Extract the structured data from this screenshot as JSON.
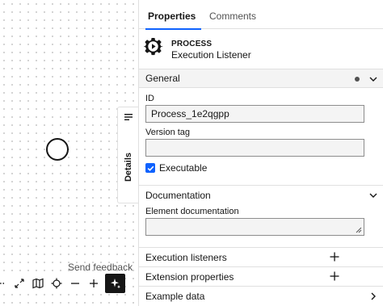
{
  "canvas": {
    "details_tab_label": "Details",
    "feedback_label": "Send feedback"
  },
  "toolbar": {
    "icons": [
      "partial-icon",
      "fullscreen-icon",
      "map-icon",
      "crosshair-icon",
      "zoom-out-icon",
      "zoom-in-icon"
    ],
    "ai_icon": "sparkle-icon"
  },
  "panel": {
    "tabs": [
      {
        "label": "Properties",
        "active": true
      },
      {
        "label": "Comments",
        "active": false
      }
    ],
    "header": {
      "type": "PROCESS",
      "name": "Execution Listener",
      "icon": "process-gear-icon"
    },
    "general": {
      "title": "General",
      "id_label": "ID",
      "id_value": "Process_1e2qgpp",
      "version_tag_label": "Version tag",
      "version_tag_value": "",
      "executable_label": "Executable",
      "executable_checked": true
    },
    "documentation": {
      "title": "Documentation",
      "element_doc_label": "Element documentation",
      "element_doc_value": ""
    },
    "execution_listeners": {
      "title": "Execution listeners"
    },
    "extension_properties": {
      "title": "Extension properties"
    },
    "example_data": {
      "title": "Example data"
    }
  },
  "colors": {
    "accent": "#0f62fe",
    "text": "#161616",
    "muted": "#525252",
    "border": "#e0e0e0",
    "group_bg": "#f4f4f4"
  }
}
